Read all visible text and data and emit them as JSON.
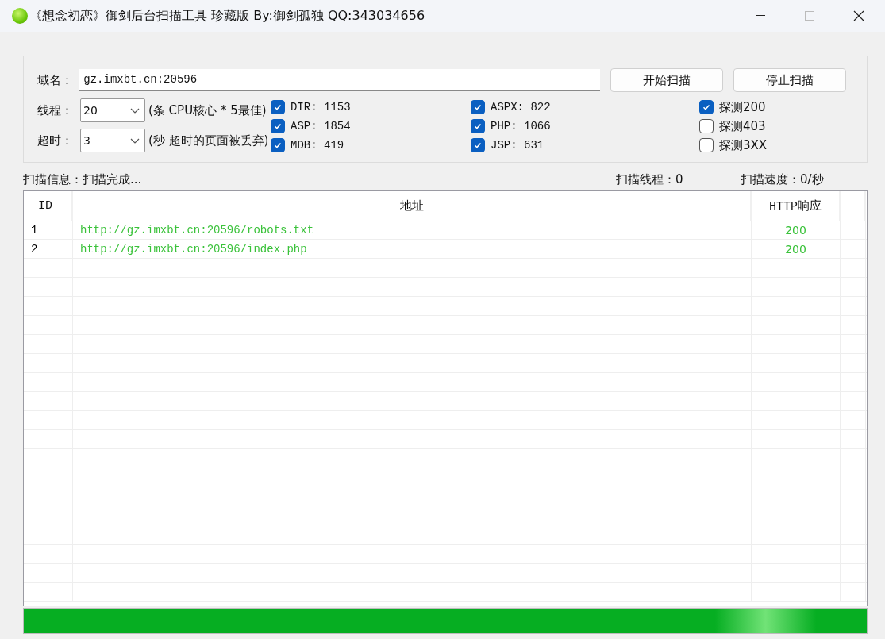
{
  "window": {
    "title": "《想念初恋》御剑后台扫描工具 珍藏版 By:御剑孤独 QQ:343034656"
  },
  "domain": {
    "label": "域名：",
    "value": "gz.imxbt.cn:20596"
  },
  "buttons": [
    "开始扫描",
    "停止扫描"
  ],
  "threads": {
    "label": "线程：",
    "value": "20",
    "note": "(条 CPU核心 * 5最佳)"
  },
  "timeout": {
    "label": "超时：",
    "value": "3",
    "note": "(秒 超时的页面被丢弃)"
  },
  "dictionaries": [
    {
      "label": "DIR: 1153",
      "checked": true
    },
    {
      "label": "ASPX: 822",
      "checked": true
    },
    {
      "label": "ASP: 1854",
      "checked": true
    },
    {
      "label": "PHP: 1066",
      "checked": true
    },
    {
      "label": "MDB: 419",
      "checked": true
    },
    {
      "label": "JSP: 631",
      "checked": true
    }
  ],
  "probes": [
    {
      "label": "探测200",
      "checked": true
    },
    {
      "label": "探测403",
      "checked": false
    },
    {
      "label": "探测3XX",
      "checked": false
    }
  ],
  "status": {
    "info": "扫描信息：扫描完成...",
    "threads": "扫描线程：0",
    "speed": "扫描速度：0/秒"
  },
  "table": {
    "columns": [
      "ID",
      "地址",
      "HTTP响应"
    ],
    "rows": [
      {
        "id": "1",
        "url": "http://gz.imxbt.cn:20596/robots.txt",
        "code": "200"
      },
      {
        "id": "2",
        "url": "http://gz.imxbt.cn:20596/index.php",
        "code": "200"
      }
    ]
  },
  "progress": {
    "level": 1
  }
}
